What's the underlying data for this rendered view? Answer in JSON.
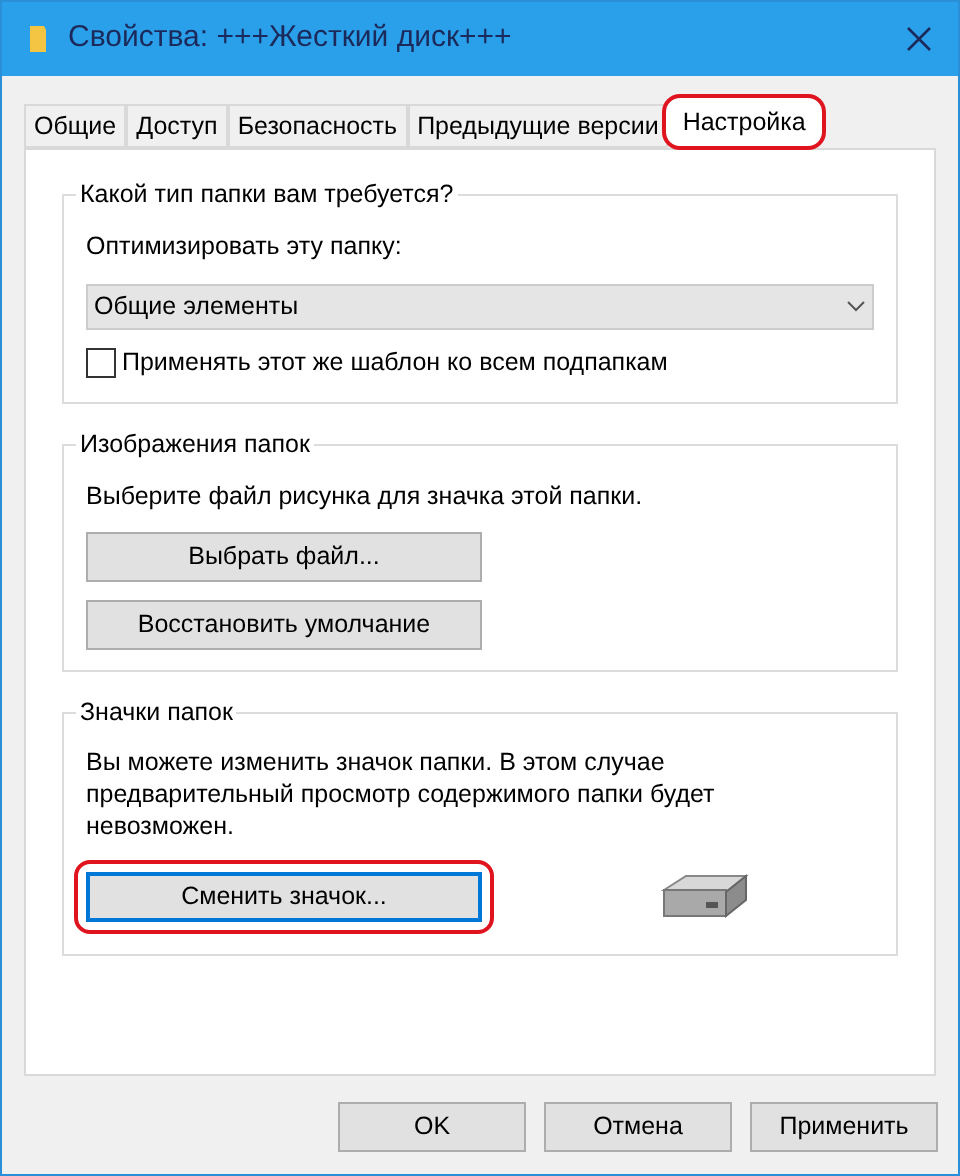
{
  "window": {
    "title": "Свойства: +++Жесткий диск+++"
  },
  "tabs": [
    {
      "label": "Общие",
      "selected": false,
      "highlighted": false
    },
    {
      "label": "Доступ",
      "selected": false,
      "highlighted": false
    },
    {
      "label": "Безопасность",
      "selected": false,
      "highlighted": false
    },
    {
      "label": "Предыдущие версии",
      "selected": false,
      "highlighted": false
    },
    {
      "label": "Настройка",
      "selected": true,
      "highlighted": true
    }
  ],
  "folder_type": {
    "legend": "Какой тип папки вам требуется?",
    "label": "Оптимизировать эту папку:",
    "dropdown": {
      "value": "Общие элементы"
    },
    "checkbox": {
      "label": "Применять этот же шаблон ко всем подпапкам",
      "checked": false
    }
  },
  "folder_pictures": {
    "legend": "Изображения папок",
    "description": "Выберите файл рисунка для значка этой папки.",
    "buttons": [
      {
        "label": "Выбрать файл..."
      },
      {
        "label": "Восстановить умолчание"
      }
    ]
  },
  "folder_icons": {
    "legend": "Значки папок",
    "description": "Вы можете изменить значок папки. В этом случае предварительный просмотр содержимого папки будет невозможен.",
    "button": {
      "label": "Сменить значок...",
      "focused": true,
      "highlighted": true
    }
  },
  "footer_buttons": [
    {
      "label": "OK"
    },
    {
      "label": "Отмена"
    },
    {
      "label": "Применить"
    }
  ]
}
